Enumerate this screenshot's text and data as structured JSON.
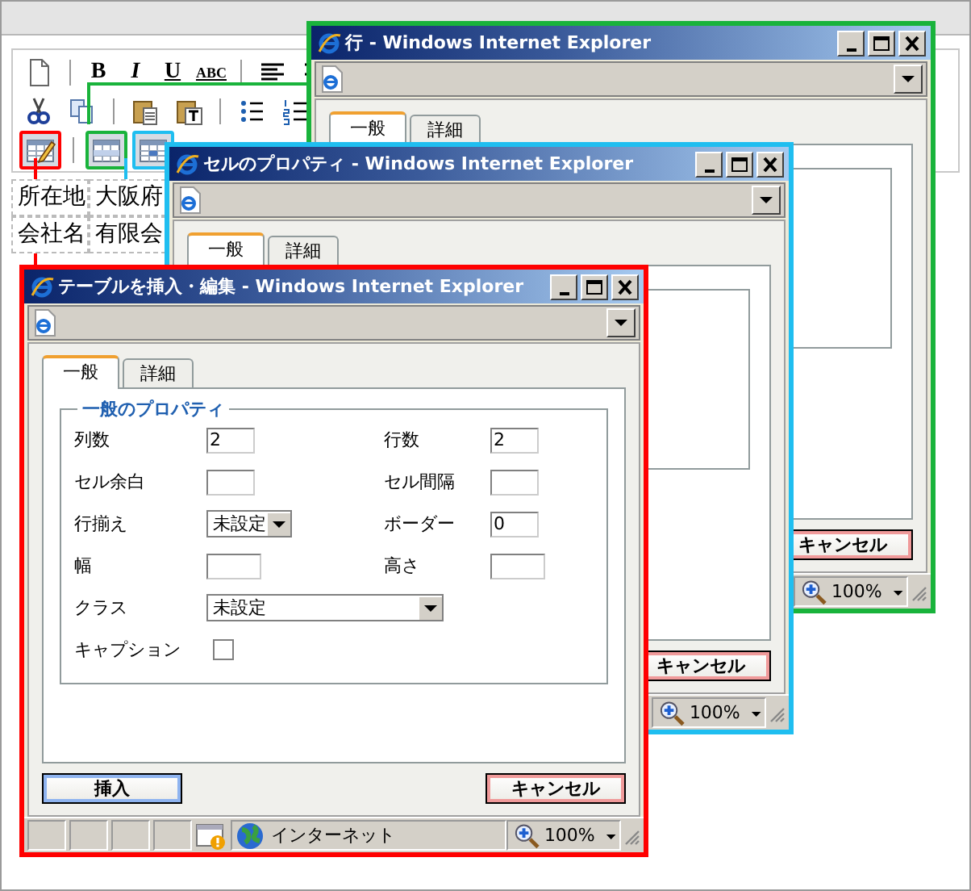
{
  "editor": {
    "format_buttons": [
      {
        "label": "B",
        "kind": "bold"
      },
      {
        "label": "I",
        "kind": "italic"
      },
      {
        "label": "U",
        "kind": "underline"
      },
      {
        "label": "ABC",
        "kind": "strike"
      }
    ],
    "table": [
      [
        "所在地",
        "大阪府"
      ],
      [
        "会社名",
        "有限会"
      ]
    ]
  },
  "windows": [
    {
      "title": "行 - Windows Internet Explorer",
      "color": "#19b33b",
      "tabs": [
        {
          "label": "一般",
          "selected": true
        },
        {
          "label": "詳細",
          "selected": false
        }
      ],
      "buttons": [
        {
          "label": "キャンセル",
          "kind": "cancel"
        }
      ],
      "status": {
        "zoom": "100%"
      }
    },
    {
      "title": "セルのプロパティ - Windows Internet Explorer",
      "color": "#1fbef0",
      "tabs": [
        {
          "label": "一般",
          "selected": true
        },
        {
          "label": "詳細",
          "selected": false
        }
      ],
      "buttons": [
        {
          "label": "キャンセル",
          "kind": "cancel"
        }
      ],
      "status": {
        "zoom": "100%"
      }
    },
    {
      "title": "テーブルを挿入・編集 - Windows Internet Explorer",
      "color": "#ff0000",
      "tabs": [
        {
          "label": "一般",
          "selected": true
        },
        {
          "label": "詳細",
          "selected": false
        }
      ],
      "form": {
        "legend": "一般のプロパティ",
        "rows": [
          [
            {
              "label": "列数",
              "kind": "text",
              "value": "2"
            },
            {
              "label": "行数",
              "kind": "text",
              "value": "2"
            }
          ],
          [
            {
              "label": "セル余白",
              "kind": "text"
            },
            {
              "label": "セル間隔",
              "kind": "text"
            }
          ],
          [
            {
              "label": "行揃え",
              "kind": "select",
              "value": "未設定"
            },
            {
              "label": "ボーダー",
              "kind": "text",
              "value": "0"
            }
          ],
          [
            {
              "label": "幅",
              "kind": "text"
            },
            {
              "label": "高さ",
              "kind": "text"
            }
          ],
          [
            {
              "label": "クラス",
              "kind": "select",
              "value": "未設定"
            }
          ],
          [
            {
              "label": "キャプション",
              "kind": "checkbox",
              "checked": false
            }
          ]
        ]
      },
      "buttons": [
        {
          "label": "挿入",
          "kind": "primary"
        },
        {
          "label": "キャンセル",
          "kind": "cancel"
        }
      ],
      "status": {
        "zone": "インターネット",
        "zoom": "100%"
      }
    }
  ]
}
